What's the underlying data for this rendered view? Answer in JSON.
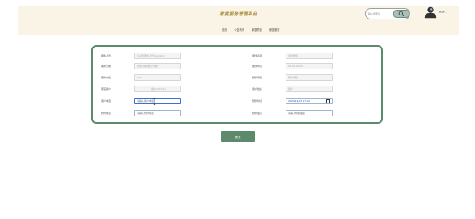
{
  "header": {
    "site_title": "家庭服务管理平台",
    "nav": [
      "首页",
      "公告资讯",
      "家庭项目",
      "家庭服务"
    ],
    "search_placeholder": "输入搜索词",
    "user_name": "RSP"
  },
  "form": {
    "left": [
      {
        "label": "服务人员",
        "value": "请设置服务人员(jianghai)",
        "editable": false
      },
      {
        "label": "服务分类",
        "value": "服务分类(服务分类)",
        "editable": false
      },
      {
        "label": "服务价格",
        "value": "150",
        "editable": false
      },
      {
        "label": "家庭用户",
        "value": "用户(12131)",
        "editable": false
      },
      {
        "label": "用户电话",
        "value": "请输入用户电话",
        "editable": true,
        "active": true
      },
      {
        "label": "预约地点",
        "value": "请输入预约地点",
        "editable": true
      }
    ],
    "right": [
      {
        "label": "服务名称",
        "value": "清洁服务",
        "editable": false
      },
      {
        "label": "服务时间",
        "value": "08:00-22:00",
        "editable": false
      },
      {
        "label": "预约须知",
        "value": "预约须知",
        "editable": false
      },
      {
        "label": "用户姓名",
        "value": "用户",
        "editable": false
      },
      {
        "label": "预约时间",
        "value": "2024/12/07 17:52",
        "editable": true,
        "datetime": true
      },
      {
        "label": "预约备注",
        "value": "请输入预约备注",
        "editable": true
      }
    ],
    "submit_label": "提交"
  },
  "colors": {
    "accent": "#5d8a6b",
    "header_bg": "#faf4e6",
    "title": "#a68e3a"
  }
}
